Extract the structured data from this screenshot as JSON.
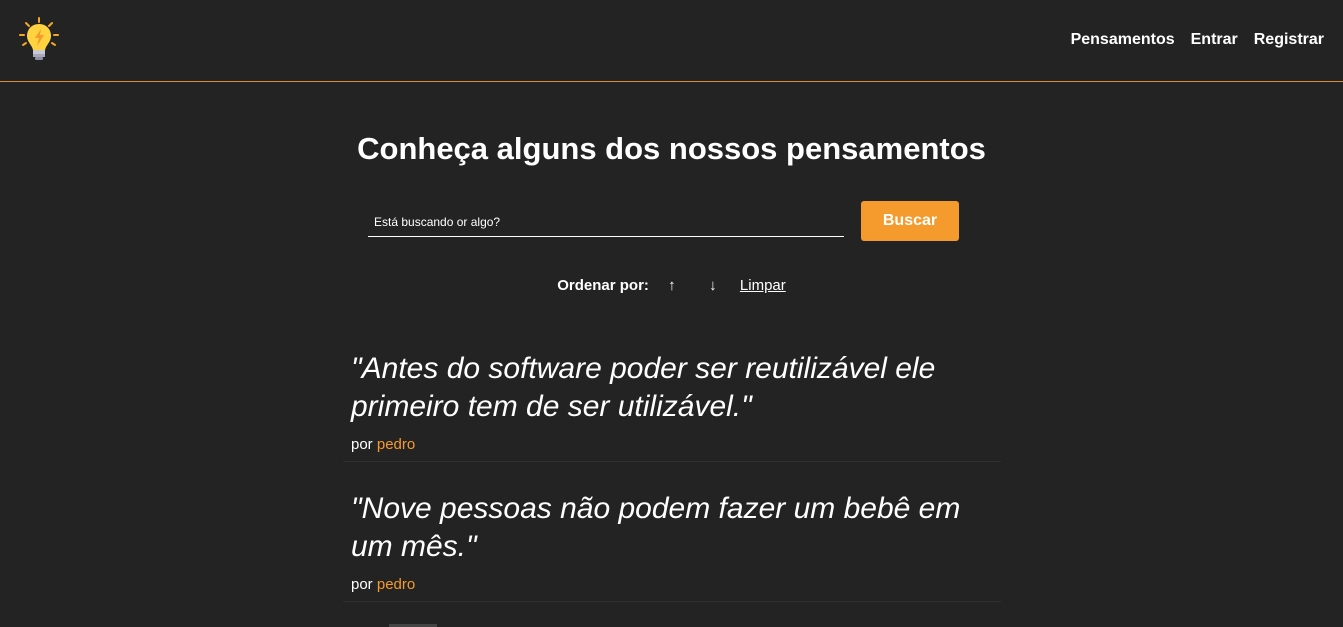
{
  "nav": {
    "logo_icon": "lightbulb-icon",
    "links": [
      "Pensamentos",
      "Entrar",
      "Registrar"
    ]
  },
  "main": {
    "title": "Conheça alguns dos nossos pensamentos",
    "search": {
      "placeholder": "Está buscando or algo?",
      "value": "",
      "button_label": "Buscar"
    },
    "sort": {
      "label": "Ordenar por:",
      "asc": "↑",
      "desc": "↓",
      "clear": "Limpar"
    },
    "thoughts": [
      {
        "text": "\"Antes do software poder ser reutilizável ele primeiro tem de ser utilizável.\"",
        "by": "por",
        "author": "pedro"
      },
      {
        "text": "\"Nove pessoas não podem fazer um bebê em um mês.\"",
        "by": "por",
        "author": "pedro"
      }
    ]
  },
  "colors": {
    "background": "#232323",
    "accent": "#f59a2d"
  }
}
